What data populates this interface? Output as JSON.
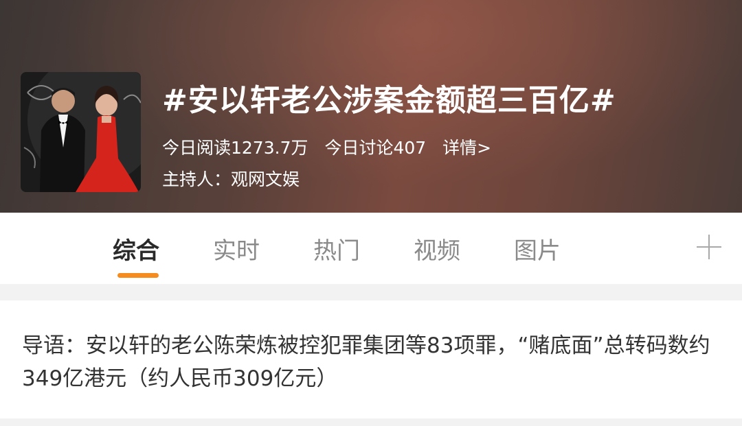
{
  "topic": {
    "title": "#安以轩老公涉案金额超三百亿#",
    "reads_today": "今日阅读1273.7万",
    "discussions_today": "今日讨论407",
    "details_link": "详情>",
    "host": "主持人：观网文娱"
  },
  "tabs": [
    {
      "label": "综合",
      "active": true
    },
    {
      "label": "实时",
      "active": false
    },
    {
      "label": "热门",
      "active": false
    },
    {
      "label": "视频",
      "active": false
    },
    {
      "label": "图片",
      "active": false
    }
  ],
  "intro": {
    "text": "导语：安以轩的老公陈荣炼被控犯罪集团等83项罪，“赌底面”总转码数约349亿港元（约人民币309亿元）"
  },
  "colors": {
    "accent": "#f58c1f",
    "header_bg": "#6f463c"
  },
  "icons": {
    "plus": "plus-icon"
  }
}
